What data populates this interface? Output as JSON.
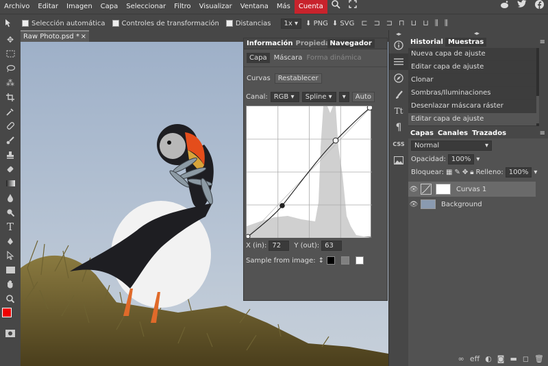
{
  "menu": {
    "items": [
      "Archivo",
      "Editar",
      "Imagen",
      "Capa",
      "Seleccionar",
      "Filtro",
      "Visualizar",
      "Ventana",
      "Más"
    ],
    "account": "Cuenta"
  },
  "options": {
    "auto_select": "Selección automática",
    "transform": "Controles de transformación",
    "distances": "Distancias",
    "zoom": "1x",
    "png": "PNG",
    "svg": "SVG"
  },
  "document": {
    "tab": "Raw Photo.psd *"
  },
  "curves": {
    "tabs": [
      "Información",
      "Propiedades",
      "Navegador"
    ],
    "subtabs": [
      "Capa",
      "Máscara",
      "Forma dinámica"
    ],
    "title": "Curvas",
    "reset": "Restablecer",
    "channel_label": "Canal:",
    "channel": "RGB",
    "mode": "Spline",
    "auto": "Auto",
    "x_label": "X (in):",
    "x_value": "72",
    "y_label": "Y (out):",
    "y_value": "63",
    "sample_label": "Sample from image:"
  },
  "history": {
    "tabs": [
      "Historial",
      "Muestras"
    ],
    "items": [
      "Nueva capa de ajuste",
      "Editar capa de ajuste",
      "Clonar",
      "Sombras/Iluminaciones",
      "Desenlazar máscara ráster",
      "Editar capa de ajuste"
    ]
  },
  "layers": {
    "tabs": [
      "Capas",
      "Canales",
      "Trazados"
    ],
    "blend": "Normal",
    "opacity_label": "Opacidad:",
    "opacity": "100%",
    "lock_label": "Bloquear:",
    "fill_label": "Relleno:",
    "fill": "100%",
    "items": [
      {
        "name": "Curvas 1"
      },
      {
        "name": "Background"
      }
    ]
  }
}
